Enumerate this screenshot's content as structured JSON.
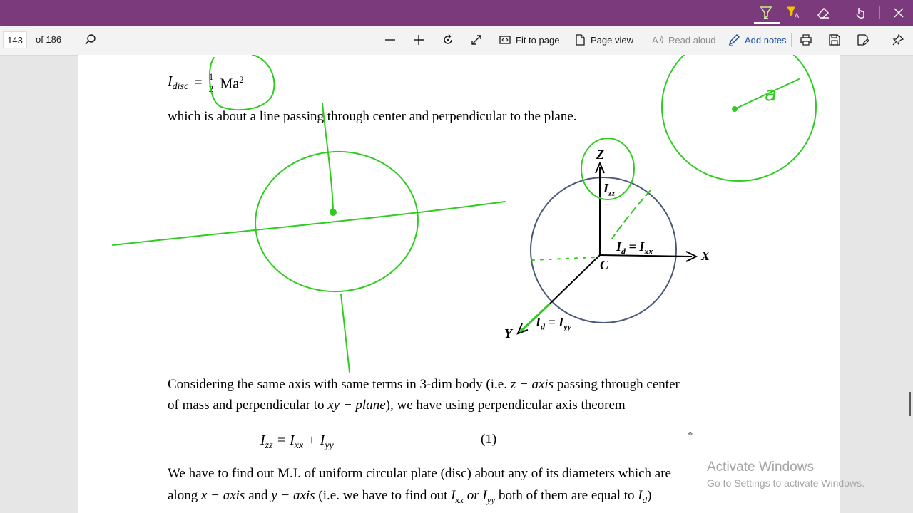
{
  "titlebar": {
    "bg": "#7b3a7c",
    "icons": [
      "highlighter-icon",
      "translate-highlight-icon",
      "eraser-icon",
      "touch-writing-icon",
      "close-icon"
    ]
  },
  "toolbar": {
    "page_number": "143",
    "page_of": "of 186",
    "fit_to_page": "Fit to page",
    "page_view": "Page view",
    "read_aloud": "Read aloud",
    "add_notes": "Add notes"
  },
  "document": {
    "eq_disc_lhs": "I",
    "eq_disc_sub": "disc",
    "eq_disc_eq": "=",
    "eq_disc_num": "1",
    "eq_disc_den": "2",
    "eq_disc_rhs": "Ma",
    "eq_disc_pow": "2",
    "line1": "which is about a line passing through center and perpendicular to the plane.",
    "diagram": {
      "z": "Z",
      "izz": "I",
      "izz_sub": "zz",
      "ixx": "I",
      "ixx_sub": "d",
      "ixx_mid": " = I",
      "ixx_sub2": "xx",
      "x": "X",
      "c": "C",
      "iyy": "I",
      "iyy_sub": "d",
      "iyy_mid": " = I",
      "iyy_sub2": "yy",
      "y": "Y"
    },
    "ink_letter": "a",
    "para1_a": "Considering the same axis with same terms in 3-dim body (i.e. ",
    "para1_m1": "z − axis",
    "para1_b": " passing through center",
    "para2_a": "of mass and perpendicular to ",
    "para2_m1": "xy − plane",
    "para2_b": "), we have using perpendicular axis theorem",
    "eq2_izz": "I",
    "eq2_izz_sub": "zz",
    "eq2_mid": " = I",
    "eq2_ixx_sub": "xx",
    "eq2_plus": " + I",
    "eq2_iyy_sub": "yy",
    "eq2_num": "(1)",
    "para3": "We have to find out M.I. of uniform circular plate (disc) about any of its diameters which are",
    "para4_a": "along ",
    "para4_m1": "x − axis",
    "para4_b": " and ",
    "para4_m2": "y − axis",
    "para4_c": "  (i.e. we have to find out ",
    "para4_m3": "I",
    "para4_m3_sub": "xx",
    "para4_m4": " or I",
    "para4_m4_sub": "yy",
    "para4_d": " both of them are equal to ",
    "para4_m5": "I",
    "para4_m5_sub": "d",
    "para4_e": ")"
  },
  "watermark": {
    "line1": "Activate Windows",
    "line2": "Go to Settings to activate Windows."
  },
  "colors": {
    "ink": "#2ecc1f",
    "circle": "#4a5a7a",
    "link": "#1a4f9c"
  }
}
